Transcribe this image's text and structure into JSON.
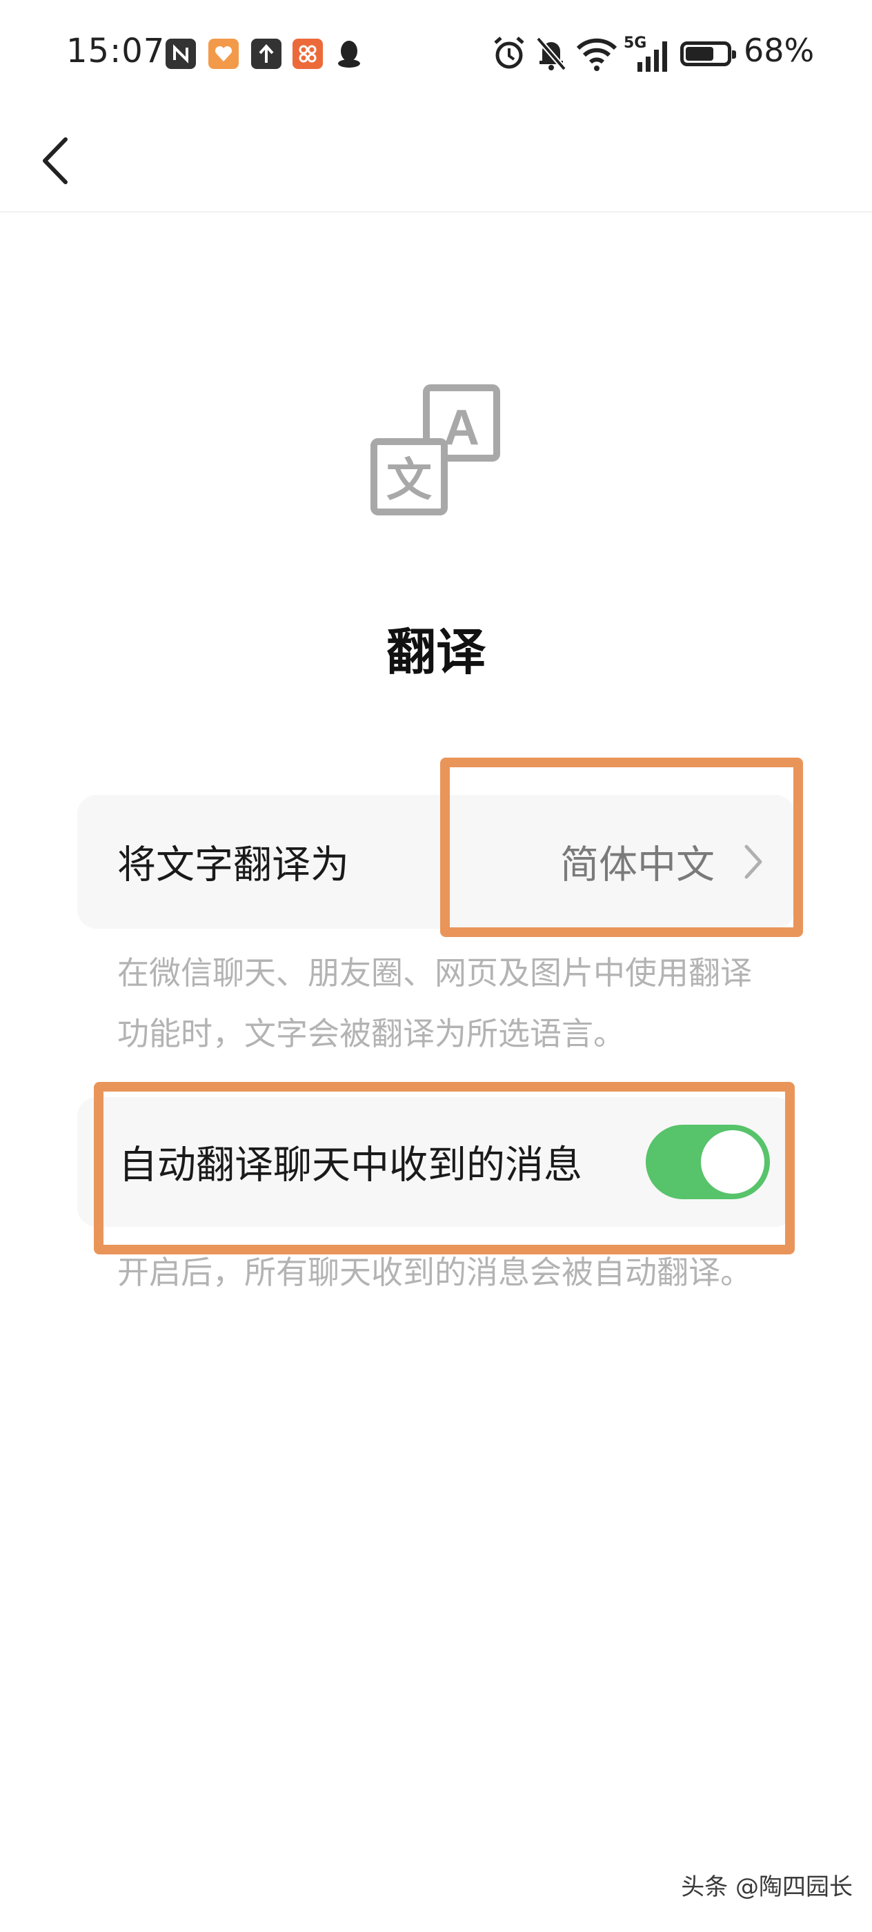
{
  "status_bar": {
    "time": "15:07",
    "battery": "68%",
    "network": "5G",
    "icons": [
      "nfc-icon",
      "heart-app-icon",
      "upload-icon",
      "grid-app-icon",
      "qq-icon",
      "alarm-icon",
      "mute-icon",
      "wifi-icon",
      "signal-icon",
      "battery-icon"
    ]
  },
  "header": {
    "back_icon": "chevron-left-icon"
  },
  "hero": {
    "icon": "translate-icon",
    "icon_letter_a": "A",
    "icon_letter_wen": "文",
    "title": "翻译"
  },
  "translate_target": {
    "label": "将文字翻译为",
    "value": "简体中文",
    "chevron_icon": "chevron-right-icon",
    "description": "在微信聊天、朋友圈、网页及图片中使用翻译功能时，文字会被翻译为所选语言。"
  },
  "auto_translate": {
    "label": "自动翻译聊天中收到的消息",
    "enabled": true,
    "description": "开启后，所有聊天收到的消息会被自动翻译。"
  },
  "colors": {
    "toggle_on": "#57c36a",
    "highlight": "#e9955a",
    "card_bg": "#f7f7f7",
    "desc_text": "#b3b3b3"
  },
  "watermark": "头条 @陶四园长"
}
